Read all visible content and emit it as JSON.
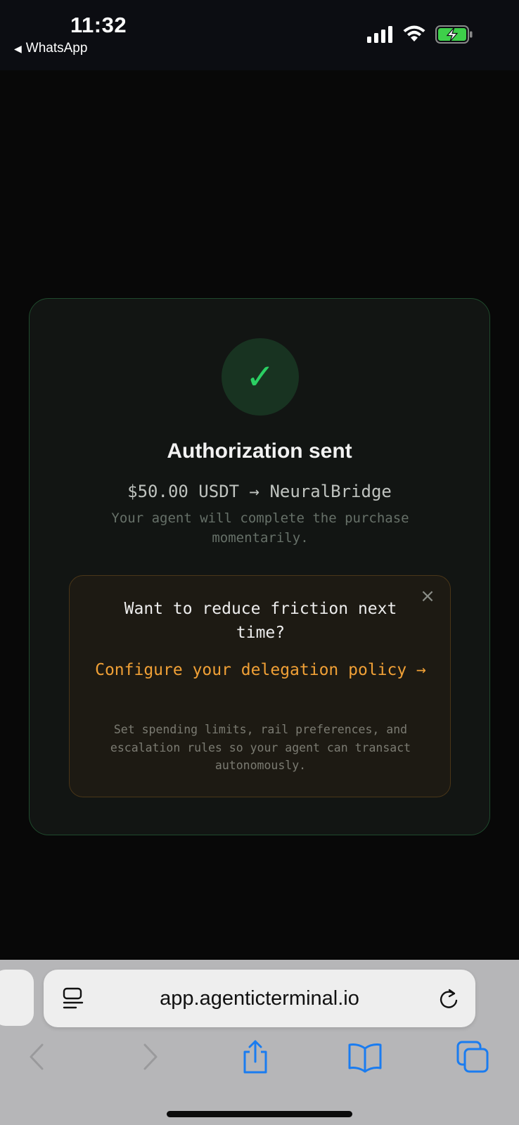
{
  "status_bar": {
    "time": "11:32",
    "back_app_label": "WhatsApp",
    "icons": [
      "signal-icon",
      "wifi-icon",
      "battery-charging-icon"
    ]
  },
  "card": {
    "icon": "checkmark-icon",
    "check_glyph": "✓",
    "title": "Authorization sent",
    "amount_line": "$50.00 USDT → NeuralBridge",
    "subtitle": "Your agent will complete the purchase momentarily.",
    "accent_color": "#2bcf63"
  },
  "promo": {
    "close_glyph": "×",
    "heading": "Want to reduce friction next time?",
    "link_text": "Configure your delegation policy →",
    "description": "Set spending limits, rail preferences, and escalation rules so your agent can transact autonomously.",
    "link_color": "#f0a036"
  },
  "browser": {
    "url": "app.agenticterminal.io",
    "toolbar": [
      "back-icon",
      "forward-icon",
      "share-icon",
      "bookmarks-icon",
      "tabs-icon"
    ],
    "accent_color": "#1a7cf0"
  }
}
